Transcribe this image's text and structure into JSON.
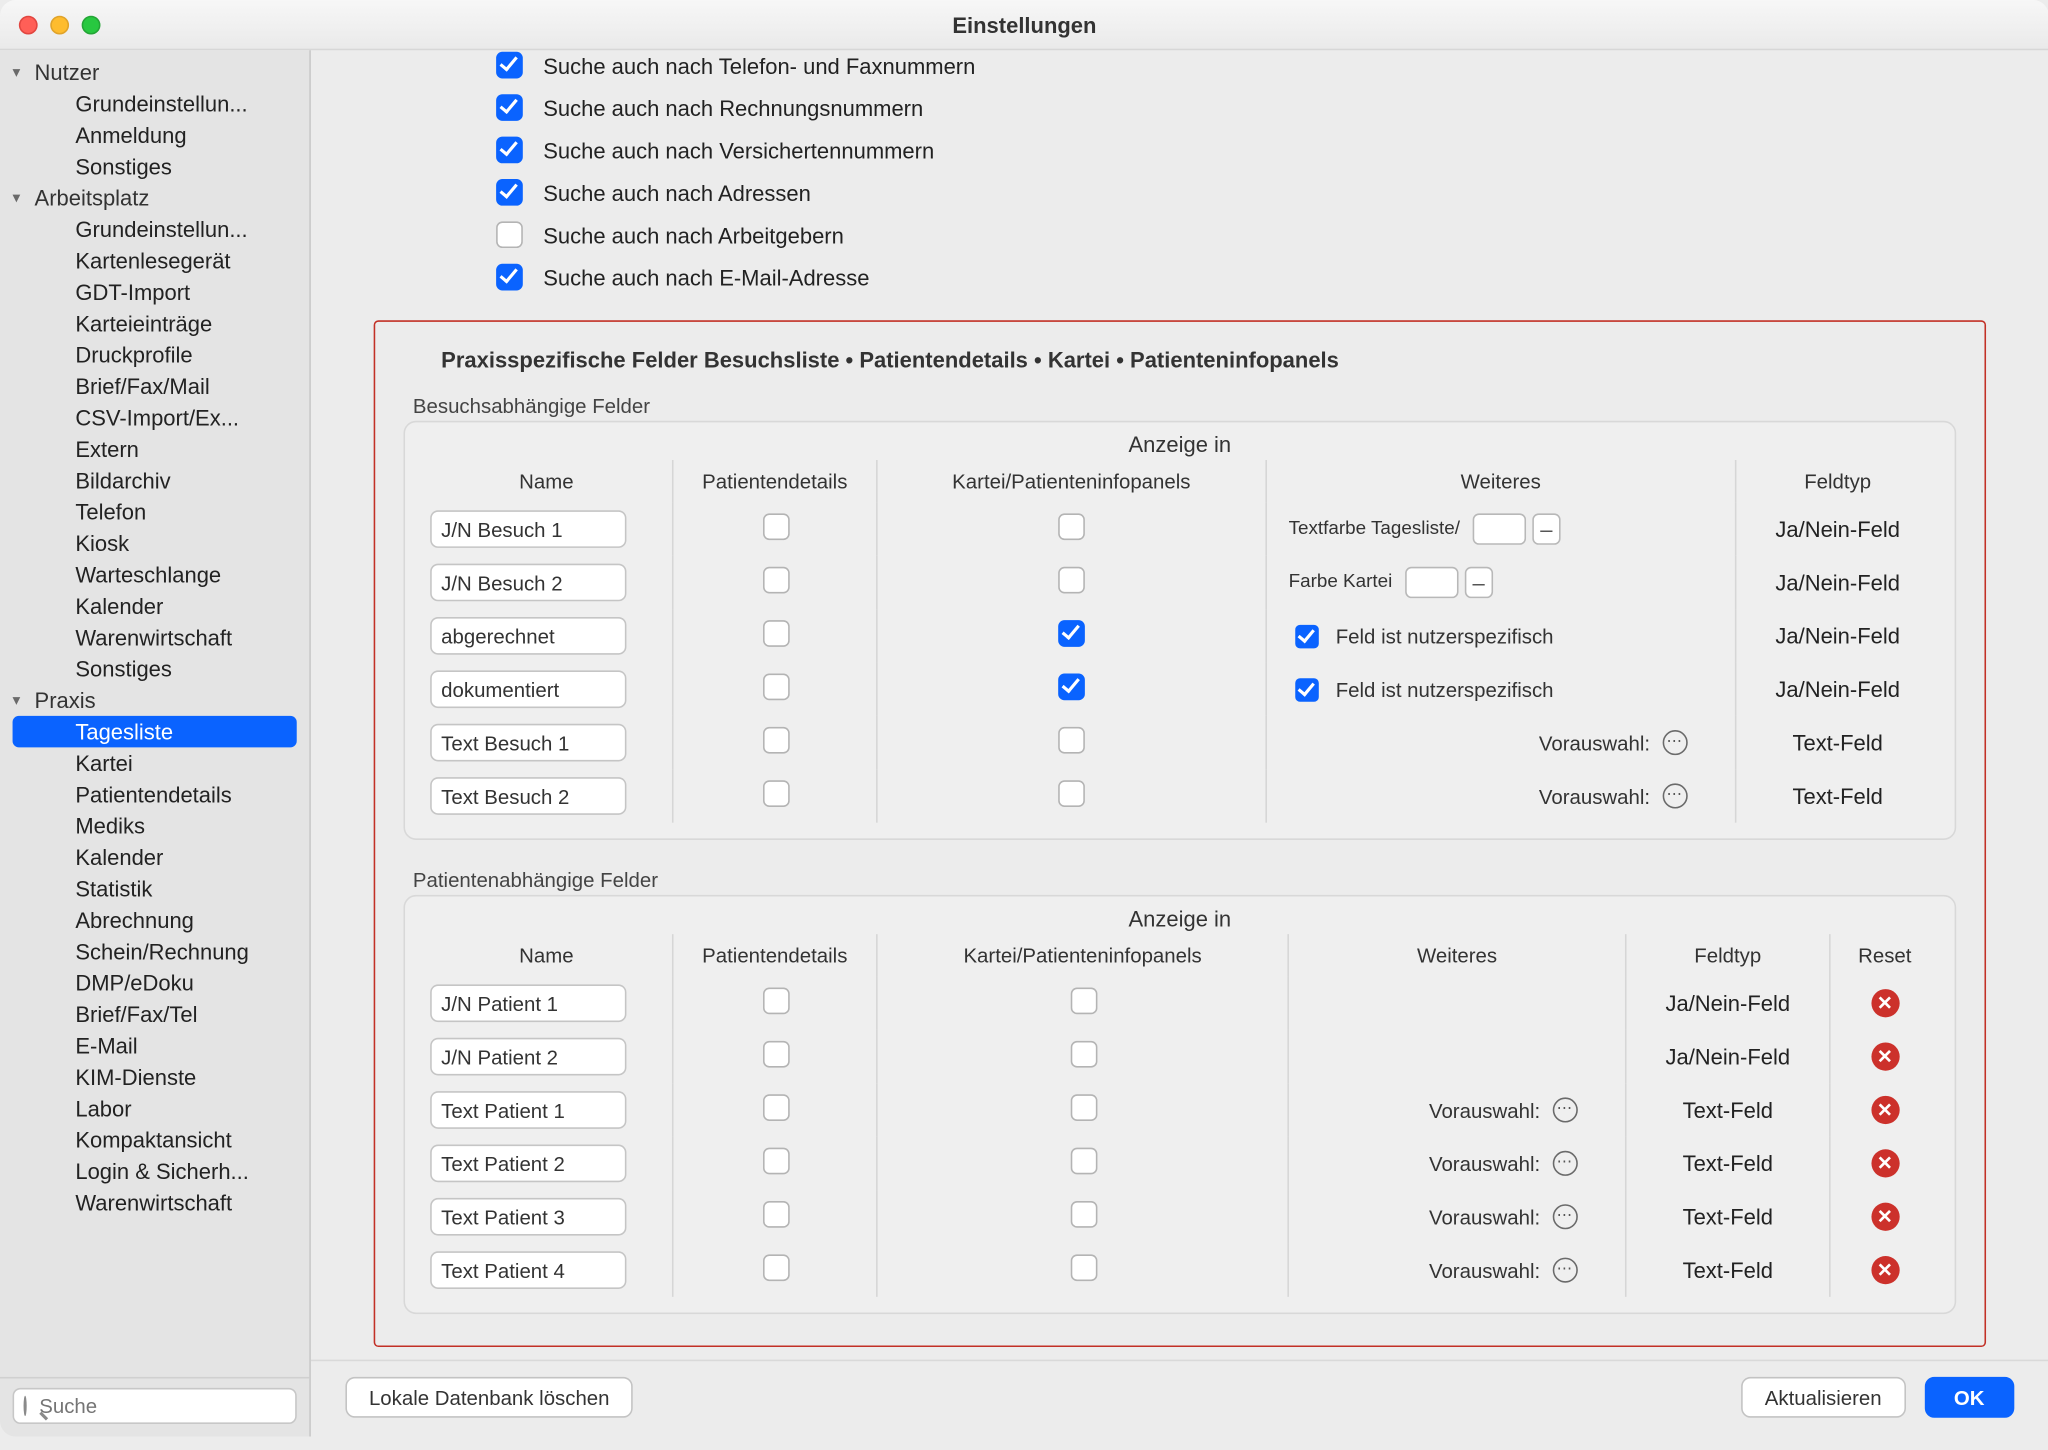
{
  "window": {
    "title": "Einstellungen"
  },
  "search": {
    "placeholder": "Suche"
  },
  "sidebar": {
    "groups": [
      {
        "label": "Nutzer",
        "expanded": true,
        "items": [
          "Grundeinstellun...",
          "Anmeldung",
          "Sonstiges"
        ]
      },
      {
        "label": "Arbeitsplatz",
        "expanded": true,
        "items": [
          "Grundeinstellun...",
          "Kartenlesegerät",
          "GDT-Import",
          "Karteieinträge",
          "Druckprofile",
          "Brief/Fax/Mail",
          "CSV-Import/Ex...",
          "Extern",
          "Bildarchiv",
          "Telefon",
          "Kiosk",
          "Warteschlange",
          "Kalender",
          "Warenwirtschaft",
          "Sonstiges"
        ]
      },
      {
        "label": "Praxis",
        "expanded": true,
        "selected_index": 0,
        "items": [
          "Tagesliste",
          "Kartei",
          "Patientendetails",
          "Mediks",
          "Kalender",
          "Statistik",
          "Abrechnung",
          "Schein/Rechnung",
          "DMP/eDoku",
          "Brief/Fax/Tel",
          "E-Mail",
          "KIM-Dienste",
          "Labor",
          "Kompaktansicht",
          "Login & Sicherh...",
          "Warenwirtschaft"
        ]
      }
    ]
  },
  "top_options": [
    {
      "label": "Suche auch nach Telefon- und Faxnummern",
      "checked": true,
      "cutoff": true
    },
    {
      "label": "Suche auch nach Rechnungsnummern",
      "checked": true
    },
    {
      "label": "Suche auch nach Versichertennummern",
      "checked": true
    },
    {
      "label": "Suche auch nach Adressen",
      "checked": true
    },
    {
      "label": "Suche auch nach Arbeitgebern",
      "checked": false
    },
    {
      "label": "Suche auch nach E-Mail-Adresse",
      "checked": true
    }
  ],
  "panel_title": "Praxisspezifische Felder Besuchsliste • Patientendetails • Kartei • Patienteninfopanels",
  "common": {
    "anzeige_in": "Anzeige in",
    "col_name": "Name",
    "col_details": "Patientendetails",
    "col_kartei": "Kartei/Patienteninfopanels",
    "col_weiteres": "Weiteres",
    "col_feldtyp": "Feldtyp",
    "col_reset": "Reset",
    "vorauswahl": "Vorauswahl:",
    "feld_nutzer": "Feld ist nutzerspezifisch",
    "textfarbe": "Textfarbe Tagesliste/",
    "farbe_kartei": "Farbe Kartei"
  },
  "besuch": {
    "label": "Besuchsabhängige Felder",
    "rows": [
      {
        "name": "J/N Besuch 1",
        "details": false,
        "kartei": false,
        "type_label": "Ja/Nein-Feld",
        "color_picker": "textfarbe"
      },
      {
        "name": "J/N Besuch 2",
        "details": false,
        "kartei": false,
        "type_label": "Ja/Nein-Feld",
        "color_picker": "farbe"
      },
      {
        "name": "abgerechnet",
        "details": false,
        "kartei": true,
        "type_label": "Ja/Nein-Feld",
        "nutzer": true
      },
      {
        "name": "dokumentiert",
        "details": false,
        "kartei": true,
        "type_label": "Ja/Nein-Feld",
        "nutzer": true
      },
      {
        "name": "Text Besuch 1",
        "details": false,
        "kartei": false,
        "type_label": "Text-Feld",
        "vorauswahl": true
      },
      {
        "name": "Text Besuch 2",
        "details": false,
        "kartei": false,
        "type_label": "Text-Feld",
        "vorauswahl": true
      }
    ]
  },
  "patient": {
    "label": "Patientenabhängige Felder",
    "rows": [
      {
        "name": "J/N Patient 1",
        "details": false,
        "kartei": false,
        "type_label": "Ja/Nein-Feld"
      },
      {
        "name": "J/N Patient 2",
        "details": false,
        "kartei": false,
        "type_label": "Ja/Nein-Feld"
      },
      {
        "name": "Text Patient 1",
        "details": false,
        "kartei": false,
        "type_label": "Text-Feld",
        "vorauswahl": true
      },
      {
        "name": "Text Patient 2",
        "details": false,
        "kartei": false,
        "type_label": "Text-Feld",
        "vorauswahl": true
      },
      {
        "name": "Text Patient 3",
        "details": false,
        "kartei": false,
        "type_label": "Text-Feld",
        "vorauswahl": true
      },
      {
        "name": "Text Patient 4",
        "details": false,
        "kartei": false,
        "type_label": "Text-Feld",
        "vorauswahl": true
      }
    ]
  },
  "buttons": {
    "delete_db": "Lokale Datenbank löschen",
    "refresh": "Aktualisieren",
    "ok": "OK"
  }
}
